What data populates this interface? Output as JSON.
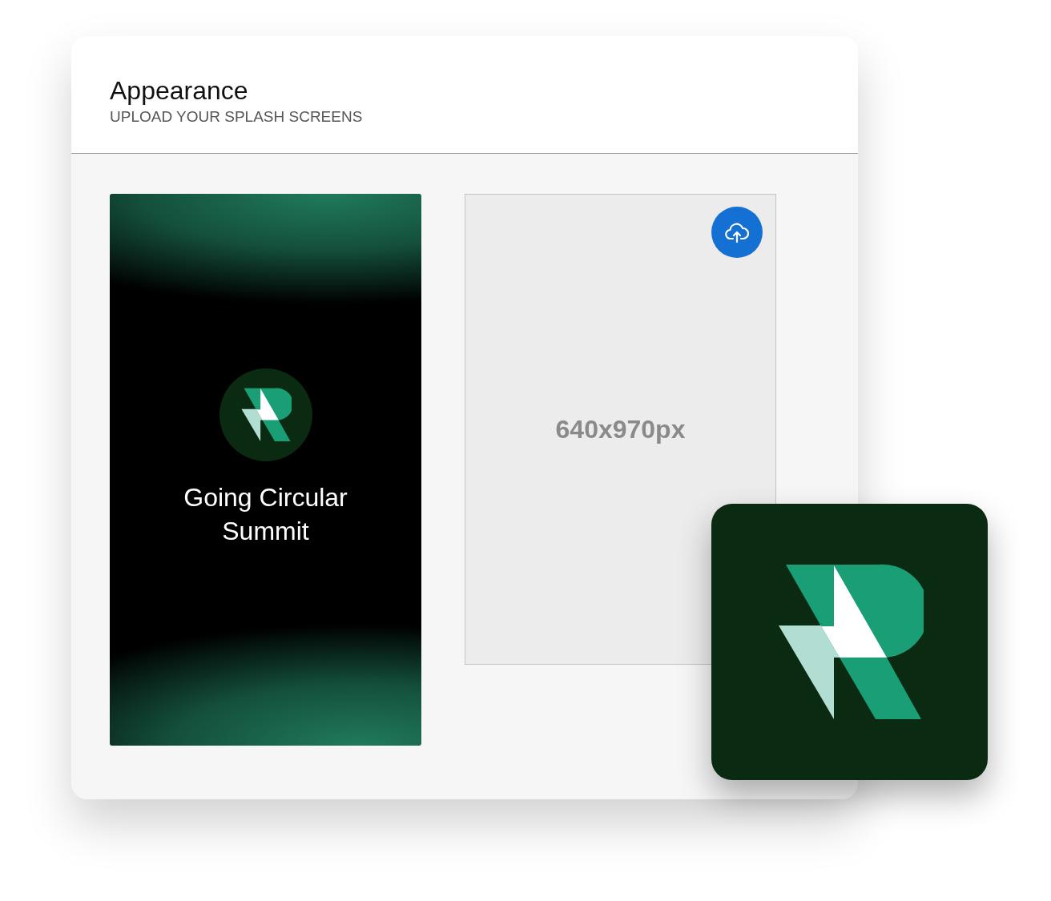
{
  "header": {
    "title": "Appearance",
    "subtitle": "UPLOAD YOUR SPLASH SCREENS"
  },
  "splash_screens": [
    {
      "kind": "image",
      "title": "Going Circular Summit"
    },
    {
      "kind": "empty",
      "size_hint": "640x970px"
    }
  ]
}
